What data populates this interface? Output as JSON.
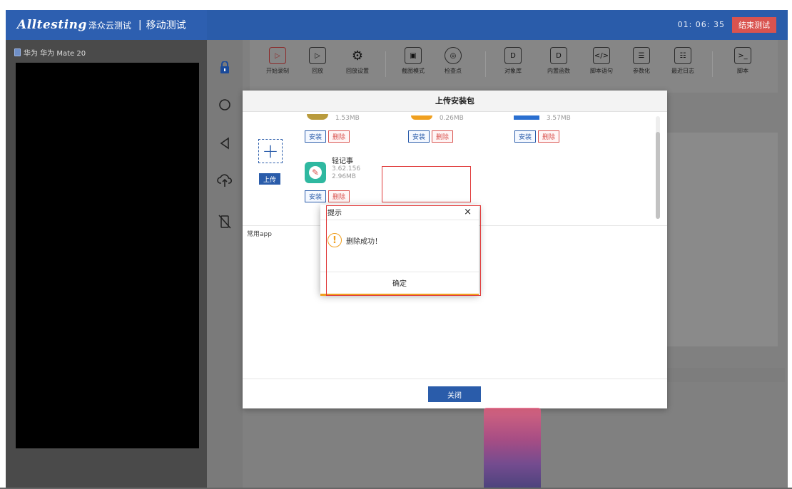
{
  "header": {
    "logo": "Alltesting",
    "logo_sub": "泽众云测试",
    "separator": "|",
    "module": "移动测试",
    "timer": "01:  06:  35",
    "end_button": "结束测试"
  },
  "device": {
    "title": "华为 华为 Mate 20"
  },
  "toolbar": {
    "tools": [
      {
        "label": "开始录制",
        "icon": "play-icon"
      },
      {
        "label": "回放",
        "icon": "replay-icon"
      },
      {
        "label": "回放设置",
        "icon": "gear-icon"
      },
      {
        "label": "截图模式",
        "icon": "image-icon"
      },
      {
        "label": "检查点",
        "icon": "checkpoint-icon"
      },
      {
        "label": "对象库",
        "icon": "object-lib-icon"
      },
      {
        "label": "内置函数",
        "icon": "function-icon"
      },
      {
        "label": "脚本语句",
        "icon": "code-icon"
      },
      {
        "label": "参数化",
        "icon": "params-icon"
      },
      {
        "label": "最近日志",
        "icon": "log-icon"
      },
      {
        "label": "脚本",
        "icon": "terminal-icon"
      }
    ]
  },
  "upload_modal": {
    "title": "上传安装包",
    "upload_button": "上传",
    "install_label": "安装",
    "delete_label": "删除",
    "top_sizes": [
      "1.53MB",
      "0.26MB",
      "3.57MB"
    ],
    "app": {
      "name": "轻记事",
      "version": "3.62.156",
      "size": "2.96MB"
    },
    "common_apps_label": "常用app",
    "close_button": "关闭"
  },
  "alert": {
    "title": "提示",
    "close_glyph": "×",
    "message": "删除成功！",
    "confirm": "确定"
  },
  "colors": {
    "brand_blue": "#2a5caa",
    "danger_red": "#d9534f",
    "warning_orange": "#f0a020"
  }
}
